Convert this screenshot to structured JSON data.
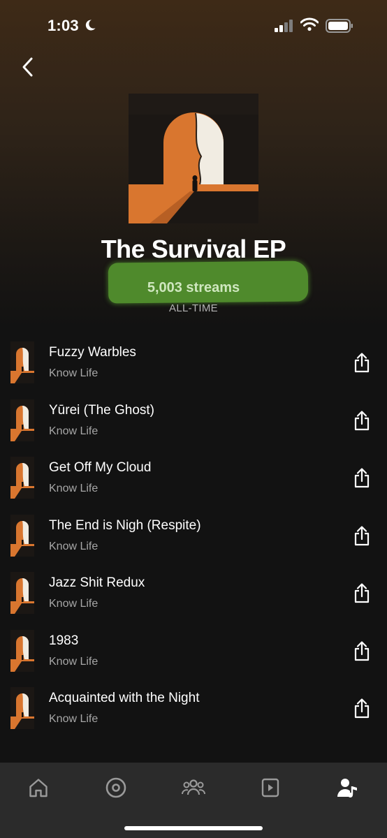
{
  "status_bar": {
    "time": "1:03",
    "icons": [
      "moon-icon",
      "signal-icon",
      "wifi-icon",
      "battery-icon"
    ]
  },
  "header": {
    "back_icon": "chevron-left-icon",
    "title": "The Survival EP",
    "streams": "5,003 streams",
    "period": "ALL-TIME",
    "highlight_color": "#4f8a2c"
  },
  "tracks": [
    {
      "title": "Fuzzy Warbles",
      "artist": "Know Life"
    },
    {
      "title": "Yūrei (The Ghost)",
      "artist": "Know Life"
    },
    {
      "title": "Get Off My Cloud",
      "artist": "Know Life"
    },
    {
      "title": "The End is Nigh (Respite)",
      "artist": "Know Life"
    },
    {
      "title": "Jazz Shit Redux",
      "artist": "Know Life"
    },
    {
      "title": "1983",
      "artist": "Know Life"
    },
    {
      "title": "Acquainted with the Night",
      "artist": "Know Life"
    }
  ],
  "bottom_nav": {
    "items": [
      "home-icon",
      "music-disc-icon",
      "audience-icon",
      "video-icon",
      "artist-profile-icon"
    ],
    "active": "artist-profile-icon"
  },
  "colors": {
    "background": "#121212",
    "accent_orange": "#d9762f",
    "secondary_text": "#a7a7a7"
  }
}
